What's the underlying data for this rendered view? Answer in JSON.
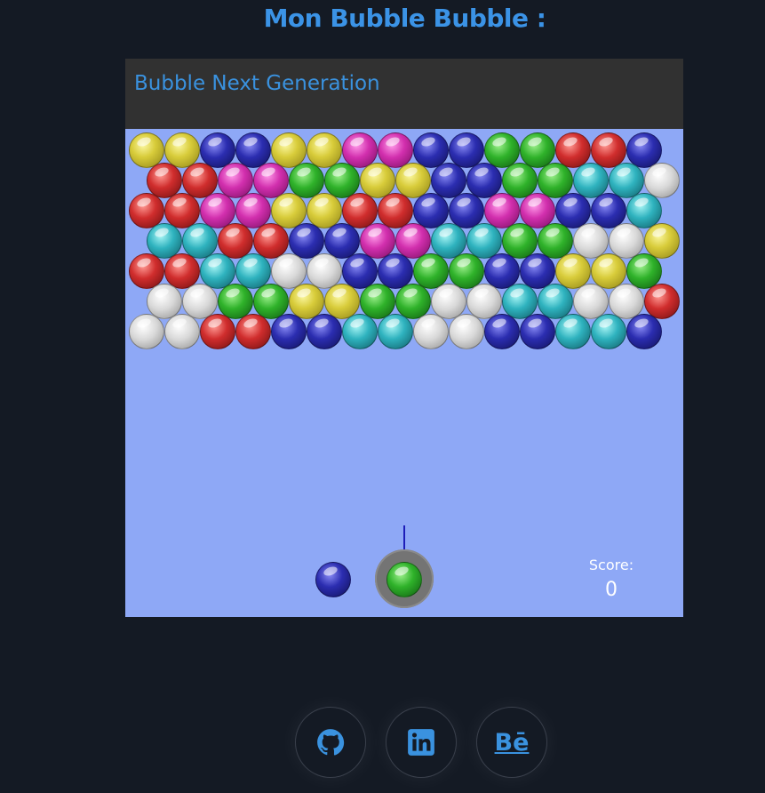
{
  "page": {
    "title": "Mon Bubble Bubble :"
  },
  "game": {
    "header_title": "Bubble Next Generation",
    "score_label": "Score:",
    "score_value": "0",
    "current_bubble": "green",
    "next_bubble": "blue",
    "bubble_rows": [
      [
        "yellow",
        "yellow",
        "blue",
        "blue",
        "yellow",
        "yellow",
        "magenta",
        "magenta",
        "blue",
        "blue",
        "green",
        "green",
        "red",
        "red",
        "blue"
      ],
      [
        "red",
        "red",
        "magenta",
        "magenta",
        "green",
        "green",
        "yellow",
        "yellow",
        "blue",
        "blue",
        "green",
        "green",
        "cyan",
        "cyan",
        "white"
      ],
      [
        "red",
        "red",
        "magenta",
        "magenta",
        "yellow",
        "yellow",
        "red",
        "red",
        "blue",
        "blue",
        "magenta",
        "magenta",
        "blue",
        "blue",
        "cyan"
      ],
      [
        "cyan",
        "cyan",
        "red",
        "red",
        "blue",
        "blue",
        "magenta",
        "magenta",
        "cyan",
        "cyan",
        "green",
        "green",
        "white",
        "white",
        "yellow"
      ],
      [
        "red",
        "red",
        "cyan",
        "cyan",
        "white",
        "white",
        "blue",
        "blue",
        "green",
        "green",
        "blue",
        "blue",
        "yellow",
        "yellow",
        "green"
      ],
      [
        "white",
        "white",
        "green",
        "green",
        "yellow",
        "yellow",
        "green",
        "green",
        "white",
        "white",
        "cyan",
        "cyan",
        "white",
        "white",
        "red"
      ],
      [
        "white",
        "white",
        "red",
        "red",
        "blue",
        "blue",
        "cyan",
        "cyan",
        "white",
        "white",
        "blue",
        "blue",
        "cyan",
        "cyan",
        "blue"
      ]
    ]
  },
  "footer": {
    "links": [
      {
        "icon": "github-icon",
        "name": "github-link"
      },
      {
        "icon": "linkedin-icon",
        "name": "linkedin-link"
      },
      {
        "icon": "behance-icon",
        "name": "behance-link",
        "label": "Bē"
      }
    ]
  },
  "colors": {
    "accent": "#3b93e6",
    "background": "#141a24",
    "game_background": "#8ea8f6",
    "header_background": "#313131"
  }
}
